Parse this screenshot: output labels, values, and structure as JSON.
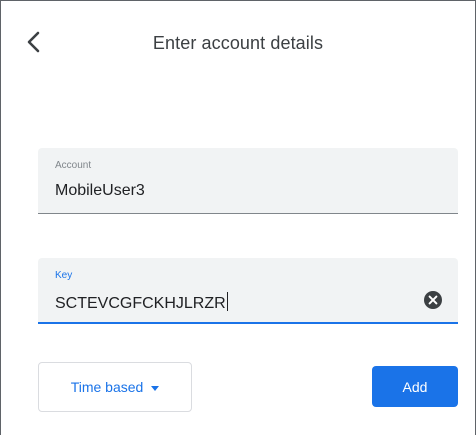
{
  "header": {
    "title": "Enter account details",
    "back_icon": "arrow-back-icon"
  },
  "form": {
    "account": {
      "label": "Account",
      "value": "MobileUser3"
    },
    "key": {
      "label": "Key",
      "value": "SCTEVCGFCKHJLRZR",
      "clear_icon": "clear-circle-icon"
    }
  },
  "footer": {
    "type_select": {
      "selected": "Time based",
      "icon": "dropdown-arrow-icon"
    },
    "add_label": "Add"
  },
  "colors": {
    "accent": "#1a73e8",
    "field_bg": "#f1f3f4",
    "label_gray": "#80868b",
    "text": "#202124"
  }
}
